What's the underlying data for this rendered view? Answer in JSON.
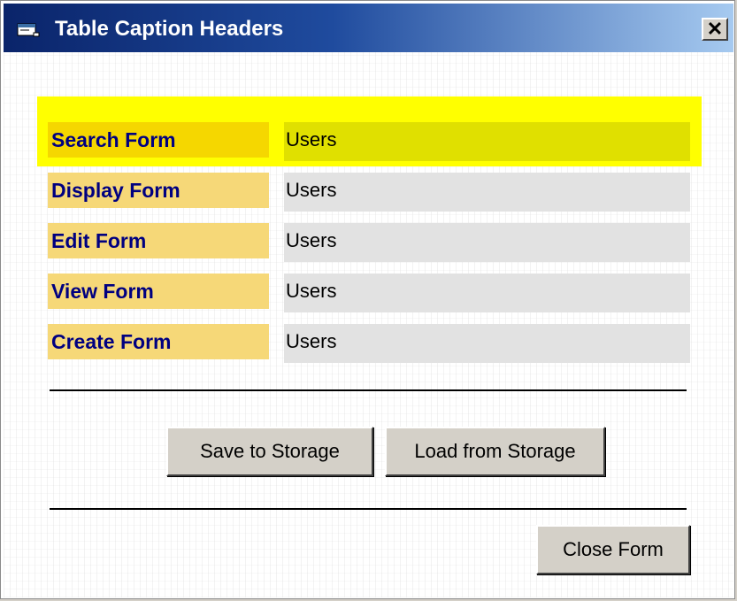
{
  "window": {
    "title": "Table Caption Headers",
    "close_glyph": "✕",
    "icon": "app-window-icon"
  },
  "form": {
    "rows": [
      {
        "label": "Search Form",
        "value": "Users"
      },
      {
        "label": "Display Form",
        "value": "Users"
      },
      {
        "label": "Edit Form",
        "value": "Users"
      },
      {
        "label": "View Form",
        "value": "Users"
      },
      {
        "label": "Create Form",
        "value": "Users"
      }
    ]
  },
  "buttons": {
    "save": "Save to Storage",
    "load": "Load from Storage",
    "close": "Close Form"
  },
  "colors": {
    "title_bar": "#0a246a",
    "highlight": "#ffff00",
    "label_bg": "#f6d878",
    "label_text": "#000080",
    "field_bg": "#e2e2e2"
  }
}
